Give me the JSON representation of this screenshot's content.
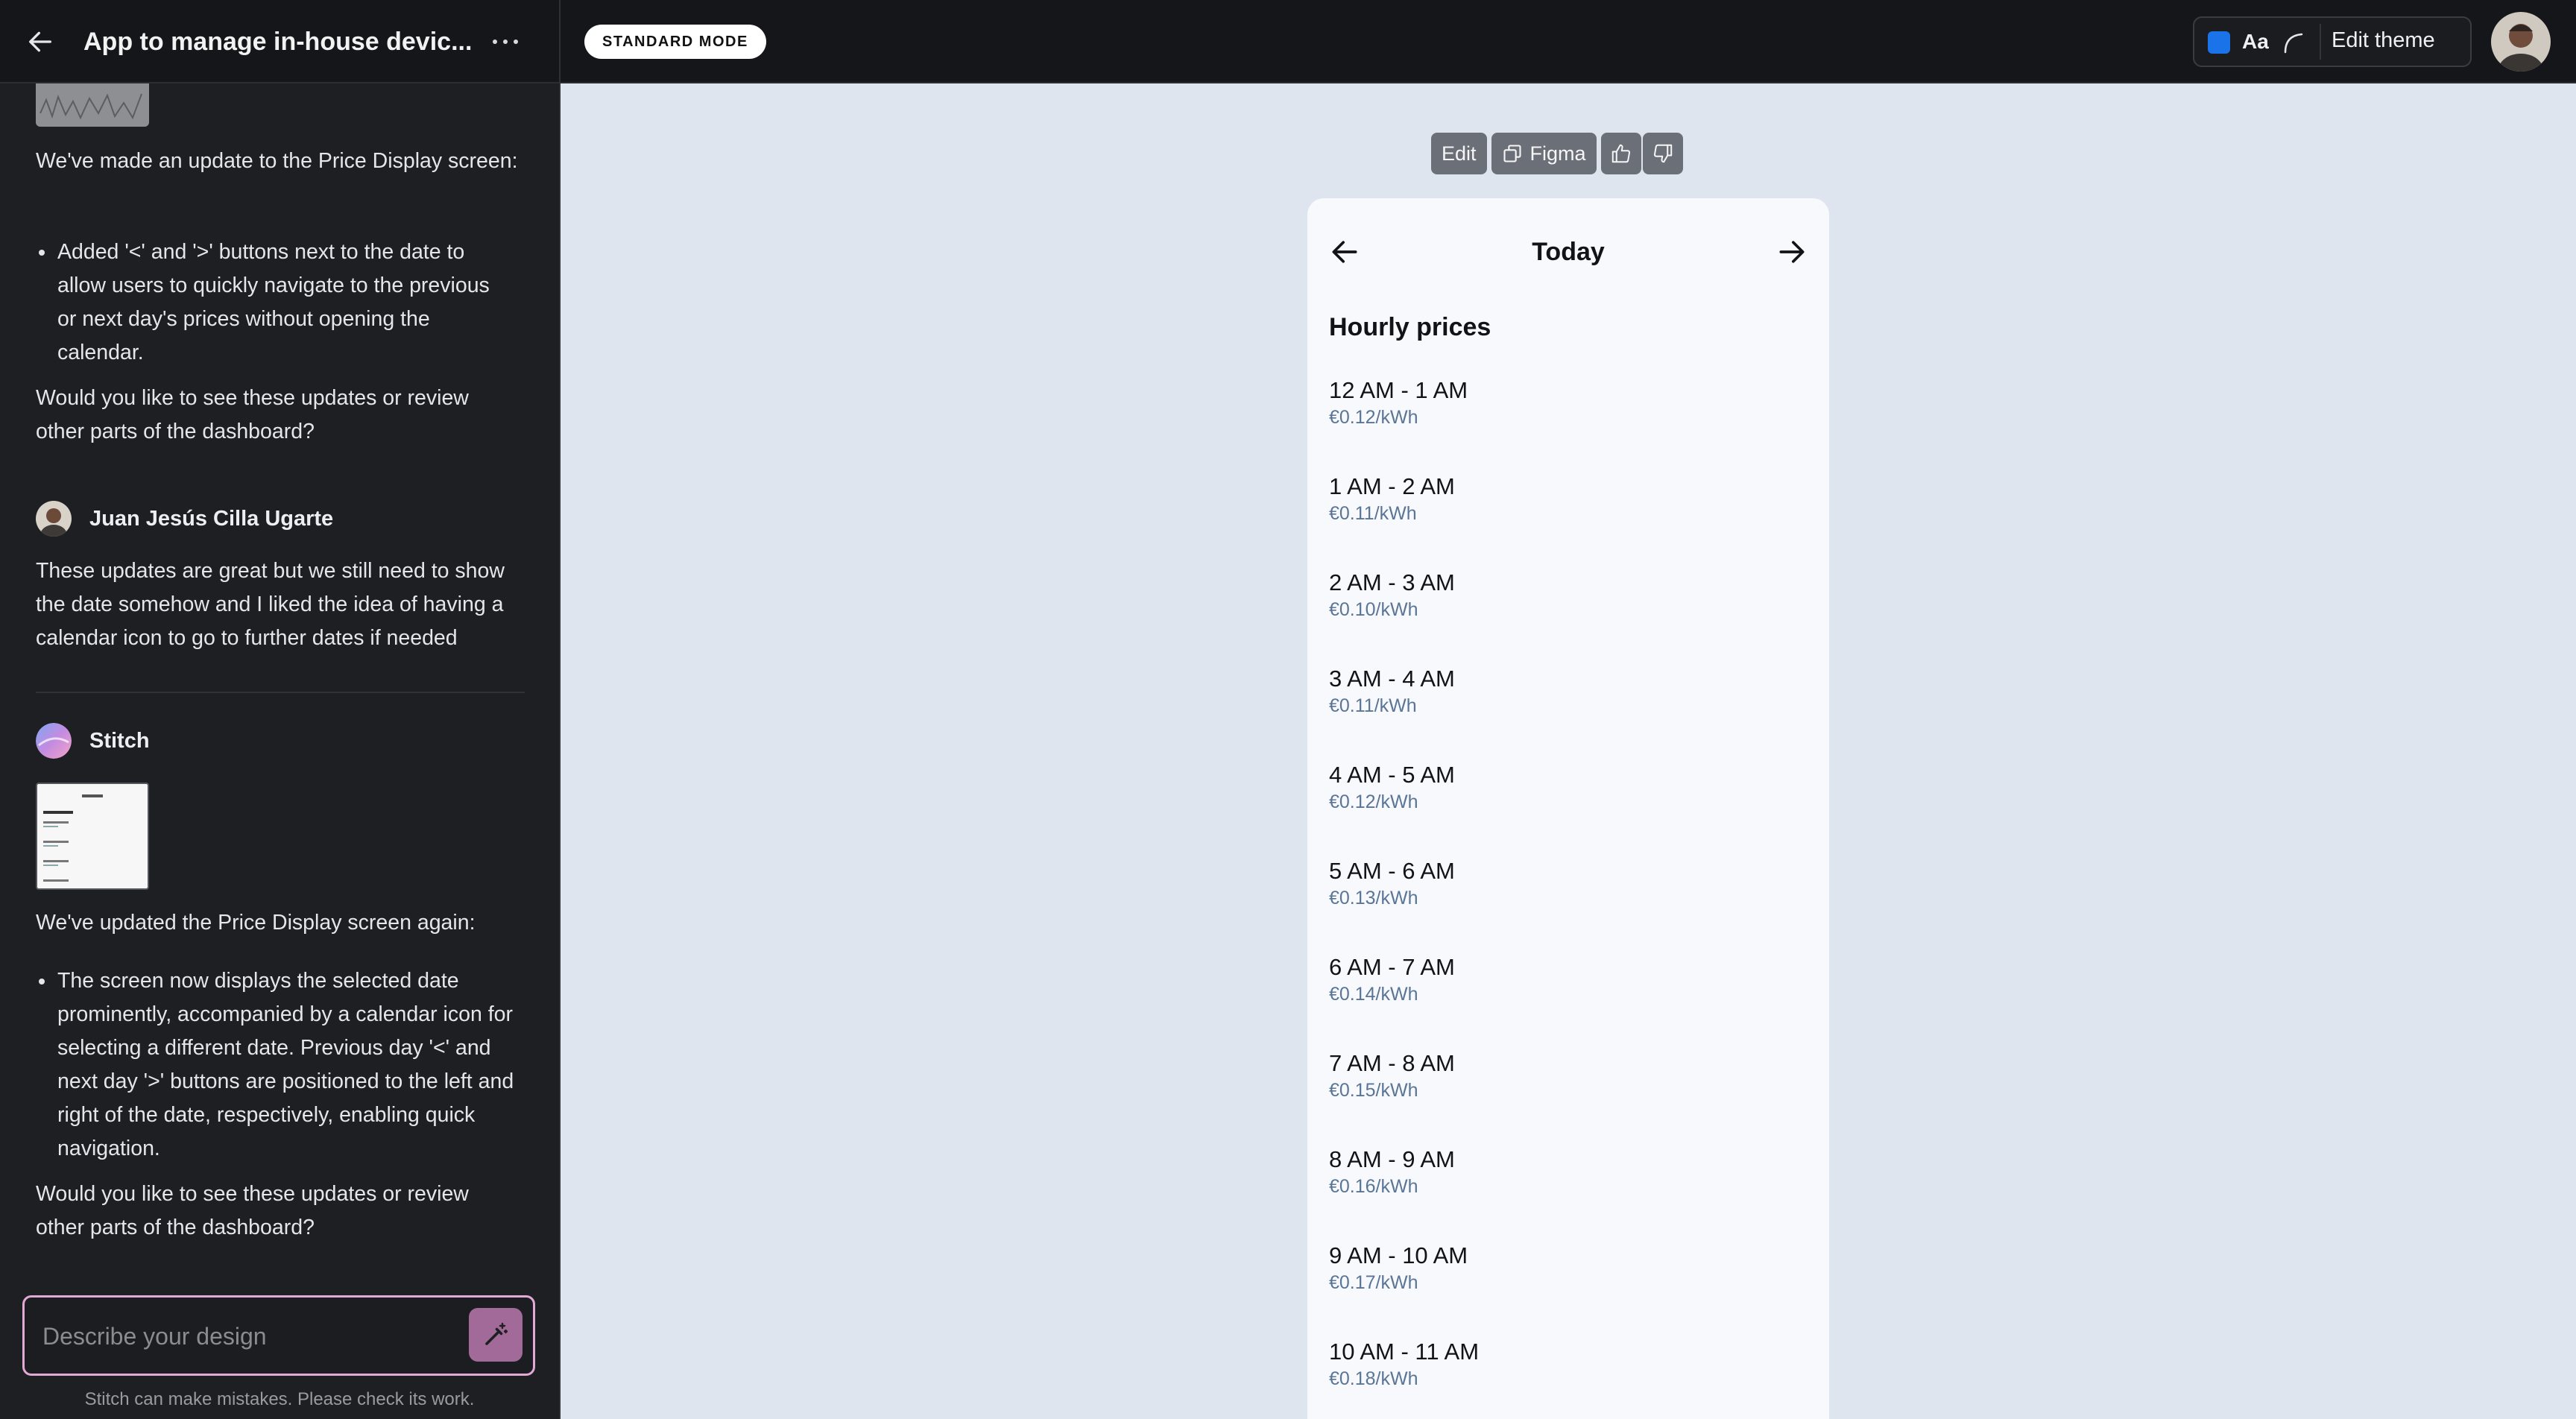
{
  "sidebar": {
    "title": "App to manage in-house devic...",
    "messages": {
      "m1_intro": "We've made an update to the Price Display screen:",
      "m1_bullet": "Added '<' and '>' buttons next to the date to allow users to quickly navigate to the previous or next day's prices without opening the calendar.",
      "m1_outro": "Would you like to see these updates or review other parts of the dashboard?",
      "user_name": "Juan Jesús Cilla Ugarte",
      "user_text": "These updates are great but we still need to show the date somehow and I liked the idea of having a calendar icon to go to further dates if needed",
      "bot_name": "Stitch",
      "m2_intro": "We've updated the Price Display screen again:",
      "m2_bullet": "The screen now displays the selected date prominently, accompanied by a calendar icon for selecting a different date. Previous day '<' and next day '>' buttons are positioned to the left and right of the date, respectively, enabling quick navigation.",
      "m2_outro": "Would you like to see these updates or review other parts of the dashboard?"
    },
    "prompt_placeholder": "Describe your design",
    "disclaimer": "Stitch can make mistakes. Please check its work."
  },
  "topbar": {
    "mode_badge": "STANDARD MODE",
    "theme_aa": "Aa",
    "theme_color": "#1a73e8",
    "edit_theme": "Edit theme"
  },
  "toolbar": {
    "edit": "Edit",
    "figma": "Figma"
  },
  "phone": {
    "date": "Today",
    "heading": "Hourly prices",
    "slots": [
      {
        "time": "12 AM - 1 AM",
        "price": "€0.12/kWh"
      },
      {
        "time": "1 AM - 2 AM",
        "price": "€0.11/kWh"
      },
      {
        "time": "2 AM - 3 AM",
        "price": "€0.10/kWh"
      },
      {
        "time": "3 AM - 4 AM",
        "price": "€0.11/kWh"
      },
      {
        "time": "4 AM - 5 AM",
        "price": "€0.12/kWh"
      },
      {
        "time": "5 AM - 6 AM",
        "price": "€0.13/kWh"
      },
      {
        "time": "6 AM - 7 AM",
        "price": "€0.14/kWh"
      },
      {
        "time": "7 AM - 8 AM",
        "price": "€0.15/kWh"
      },
      {
        "time": "8 AM - 9 AM",
        "price": "€0.16/kWh"
      },
      {
        "time": "9 AM - 10 AM",
        "price": "€0.17/kWh"
      },
      {
        "time": "10 AM - 11 AM",
        "price": "€0.18/kWh"
      }
    ]
  }
}
